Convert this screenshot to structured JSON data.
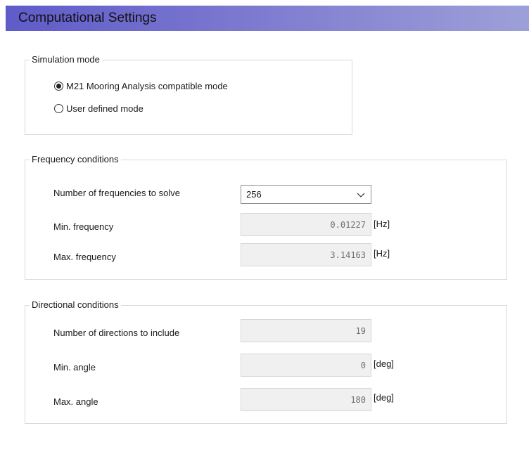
{
  "title": "Computational Settings",
  "simulation_mode": {
    "legend": "Simulation mode",
    "options": [
      {
        "label": "M21 Mooring Analysis compatible mode",
        "selected": true
      },
      {
        "label": "User defined mode",
        "selected": false
      }
    ]
  },
  "frequency": {
    "legend": "Frequency conditions",
    "num_label": "Number of frequencies to solve",
    "num_value": "256",
    "min_label": "Min. frequency",
    "min_value": "0.01227",
    "min_unit": "[Hz]",
    "max_label": "Max. frequency",
    "max_value": "3.14163",
    "max_unit": "[Hz]"
  },
  "directional": {
    "legend": "Directional conditions",
    "num_label": "Number of directions to include",
    "num_value": "19",
    "min_label": "Min. angle",
    "min_value": "0",
    "min_unit": "[deg]",
    "max_label": "Max. angle",
    "max_value": "180",
    "max_unit": "[deg]"
  }
}
